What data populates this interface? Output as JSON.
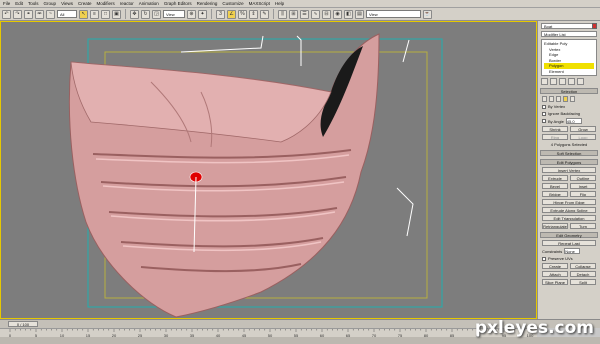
{
  "menu": [
    "File",
    "Edit",
    "Tools",
    "Group",
    "Views",
    "Create",
    "Modifiers",
    "reactor",
    "Animation",
    "Graph Editors",
    "Rendering",
    "Customize",
    "MAXScript",
    "Help"
  ],
  "toolbar": {
    "filter_select": "All",
    "coord_select": "View",
    "named_set_select": "View"
  },
  "viewport": {
    "label": ""
  },
  "panel": {
    "object_name": "Boat",
    "modifier_list": "Modifier List",
    "stack": {
      "root": "Editable Poly",
      "items": [
        "Vertex",
        "Edge",
        "Border",
        "Polygon",
        "Element"
      ],
      "selected": "Polygon"
    },
    "selection": {
      "title": "Selection",
      "by_vertex": "By Vertex",
      "ignore_backfacing": "Ignore Backfacing",
      "by_angle": "By Angle",
      "by_angle_value": "45.0",
      "shrink": "Shrink",
      "grow": "Grow",
      "ring": "Ring",
      "loop": "Loop",
      "status": "4 Polygons Selected"
    },
    "soft_selection": {
      "title": "Soft Selection"
    },
    "edit_polygons": {
      "title": "Edit Polygons",
      "insert_vertex": "Insert Vertex",
      "extrude": "Extrude",
      "outline": "Outline",
      "bevel": "Bevel",
      "inset": "Inset",
      "bridge": "Bridge",
      "flip": "Flip",
      "hinge": "Hinge From Edge",
      "extrude_spline": "Extrude Along Spline",
      "edit_triangulation": "Edit Triangulation",
      "retriangulate": "Retriangulate",
      "turn": "Turn"
    },
    "edit_geometry": {
      "title": "Edit Geometry",
      "repeat_last": "Repeat Last",
      "constraints_label": "Constraints",
      "constraints_value": "None",
      "preserve_uvs": "Preserve UVs",
      "create": "Create",
      "collapse": "Collapse",
      "attach": "Attach",
      "detach": "Detach",
      "slice_plane": "Slice Plane",
      "split": "Split"
    }
  },
  "timeline": {
    "frame": "0 / 100"
  },
  "ruler": {
    "ticks": [
      "0",
      "5",
      "10",
      "15",
      "20",
      "25",
      "30",
      "35",
      "40",
      "45",
      "50",
      "55",
      "60",
      "65",
      "70",
      "75",
      "80",
      "85",
      "90",
      "95",
      "100"
    ]
  },
  "watermark": "pxleyes.com",
  "colors": {
    "viewport_bg": "#7d7d7d",
    "active_border": "#e6c800",
    "mesh": "#d8a0a0",
    "selected_poly": "#e00000",
    "safe_frame": "#20b0b0"
  }
}
